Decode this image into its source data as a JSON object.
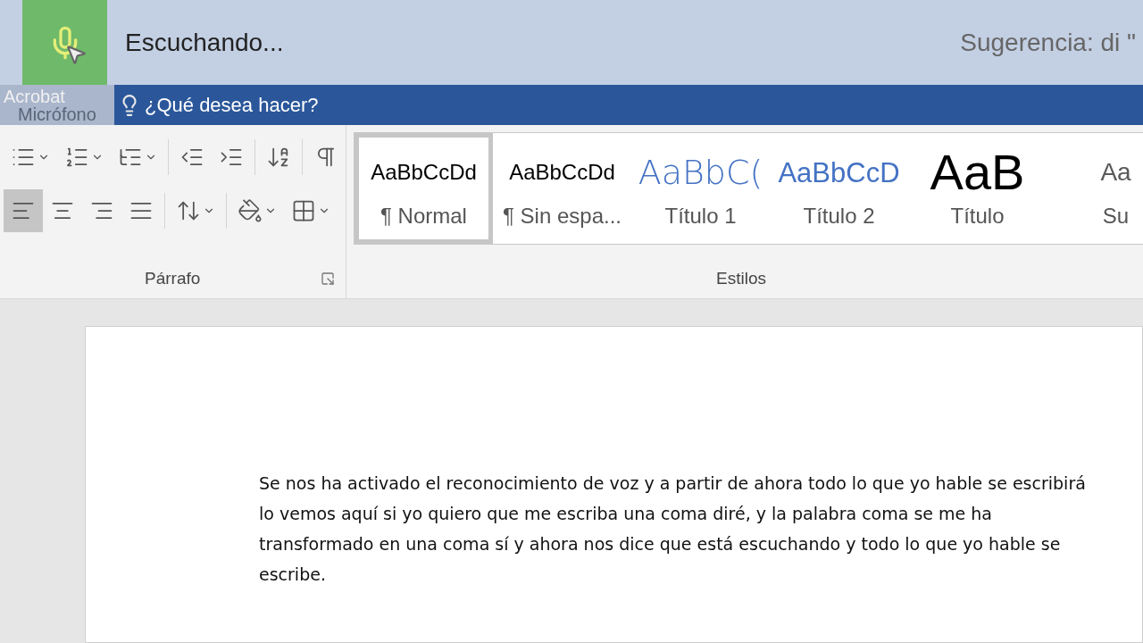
{
  "dictation": {
    "mic_active": true,
    "status": "Escuchando...",
    "hint": "Sugerencia: di \""
  },
  "ribbon_tabs": {
    "tab": "Acrobat",
    "tooltip": "Micrófono",
    "tell_me": "¿Qué desea hacer?"
  },
  "paragraph": {
    "label": "Párrafo",
    "rows": [
      [
        {
          "kind": "bullets",
          "dropdown": true
        },
        {
          "kind": "numbering",
          "dropdown": true
        },
        {
          "kind": "multilevel",
          "dropdown": true
        },
        {
          "kind": "sep"
        },
        {
          "kind": "outdent"
        },
        {
          "kind": "indent"
        },
        {
          "kind": "sep"
        },
        {
          "kind": "sort"
        },
        {
          "kind": "sep"
        },
        {
          "kind": "pilcrow"
        }
      ],
      [
        {
          "kind": "align-left",
          "selected": true
        },
        {
          "kind": "align-center",
          "selected": false
        },
        {
          "kind": "align-right",
          "selected": false
        },
        {
          "kind": "justify",
          "selected": false
        },
        {
          "kind": "sep"
        },
        {
          "kind": "spacing",
          "dropdown": true
        },
        {
          "kind": "sep"
        },
        {
          "kind": "shading",
          "dropdown": true
        },
        {
          "kind": "borders",
          "dropdown": true
        }
      ]
    ]
  },
  "styles": {
    "label": "Estilos",
    "items": [
      {
        "preview": "AaBbCcDd",
        "name": "¶ Normal",
        "kind": "body",
        "selected": true
      },
      {
        "preview": "AaBbCcDd",
        "name": "¶ Sin espa...",
        "kind": "body",
        "selected": false
      },
      {
        "preview": "AaBbC(",
        "name": "Título 1",
        "kind": "heading1",
        "selected": false
      },
      {
        "preview": "AaBbCcD",
        "name": "Título 2",
        "kind": "heading2",
        "selected": false
      },
      {
        "preview": "AaB",
        "name": "Título",
        "kind": "title",
        "selected": false
      },
      {
        "preview": "Aa",
        "name": "Su",
        "kind": "subtitle",
        "selected": false
      }
    ]
  },
  "document": {
    "paragraph": "Se nos ha activado el reconocimiento de voz y a partir de ahora todo lo que yo hable se escribirá lo vemos aquí si yo quiero que me escriba una coma diré, y la palabra coma se me ha transformado en una coma sí y ahora nos dice que está escuchando y todo lo que yo hable se escribe."
  }
}
